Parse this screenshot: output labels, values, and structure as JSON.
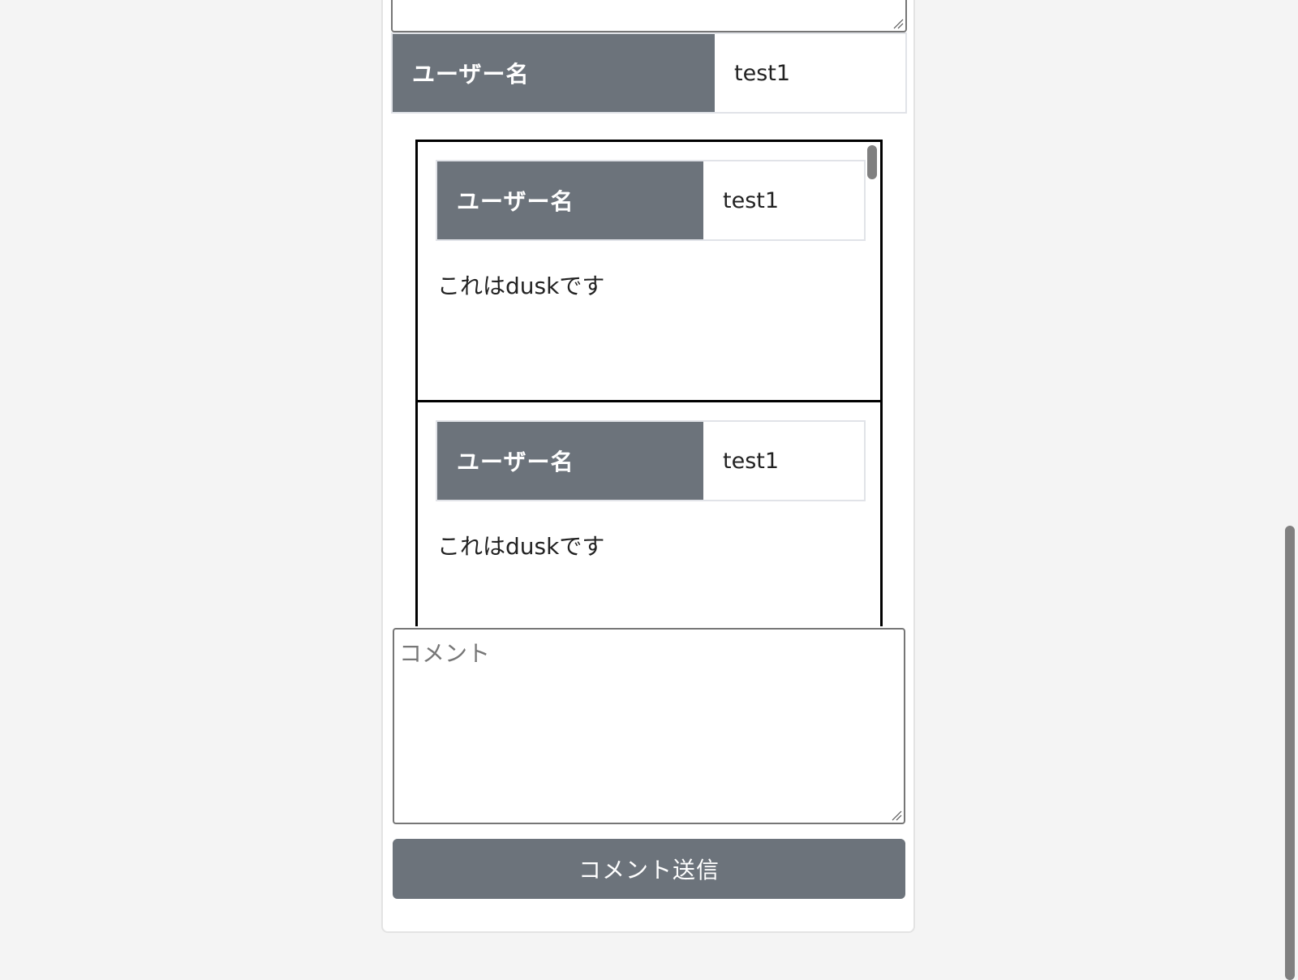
{
  "post": {
    "user_label": "ユーザー名",
    "user_value": "test1"
  },
  "comments": [
    {
      "user_label": "ユーザー名",
      "user_value": "test1",
      "body": "これはduskです"
    },
    {
      "user_label": "ユーザー名",
      "user_value": "test1",
      "body": "これはduskです"
    }
  ],
  "comment_form": {
    "placeholder": "コメント",
    "value": "",
    "submit_label": "コメント送信"
  },
  "colors": {
    "header_cell": "#6c737b",
    "button": "#6c737b",
    "background": "#f4f4f4"
  }
}
